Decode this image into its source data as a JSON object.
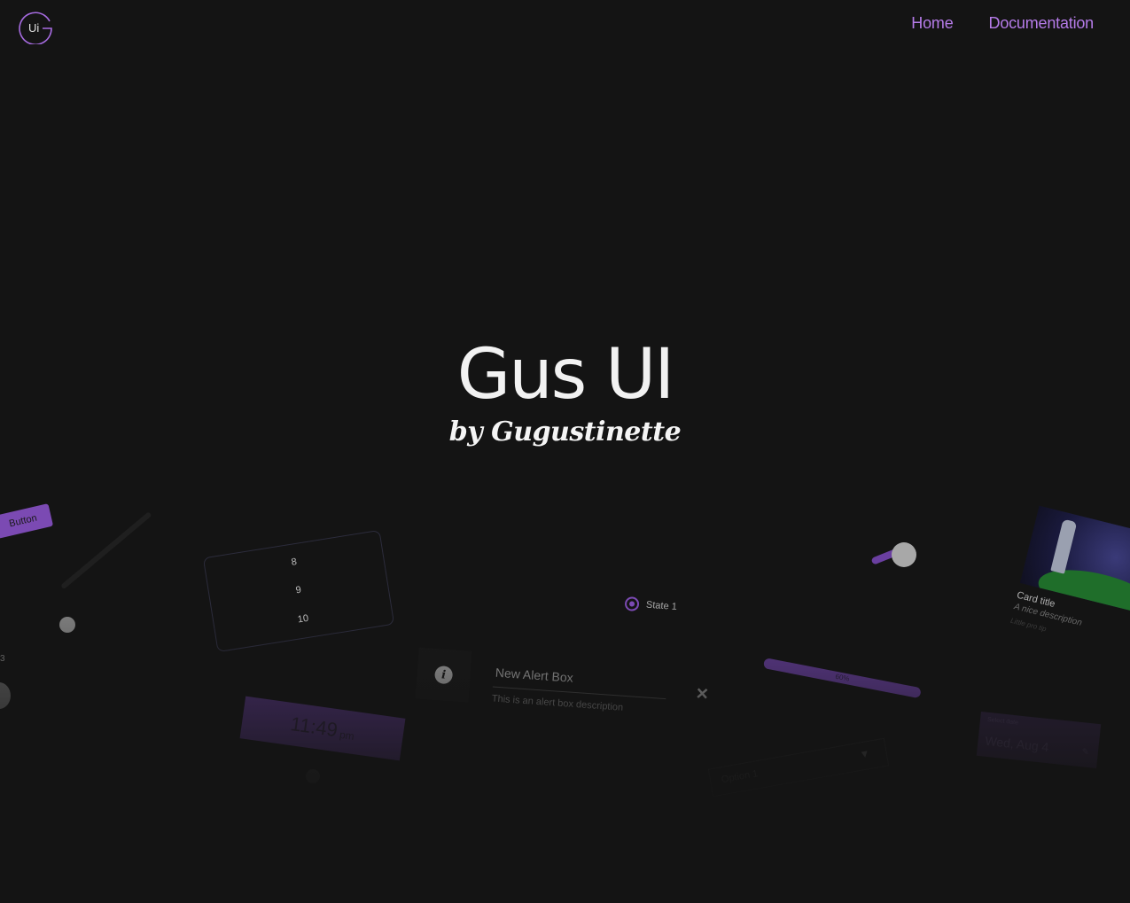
{
  "header": {
    "logo_text": "Ui",
    "nav": [
      {
        "label": "Home"
      },
      {
        "label": "Documentation"
      }
    ]
  },
  "hero": {
    "title": "Gus UI",
    "subtitle": "by Gugustinette"
  },
  "showcase": {
    "button_label": "Button",
    "picker_values": [
      "8",
      "9",
      "10"
    ],
    "radio_label": "State 1",
    "side_number": "3",
    "card": {
      "title": "Card title",
      "description": "A nice description",
      "footnote": "Little pro tip"
    },
    "alert": {
      "title": "New Alert Box",
      "description": "This is an alert box description"
    },
    "progress_label": "60%",
    "time": {
      "value": "11:49",
      "suffix": "pm"
    },
    "select_value": "Option 1",
    "date": {
      "label": "Select date",
      "value": "Wed, Aug 4"
    }
  },
  "colors": {
    "background": "#141414",
    "accent": "#b57be8",
    "accent_dark": "#7b4ab3"
  }
}
